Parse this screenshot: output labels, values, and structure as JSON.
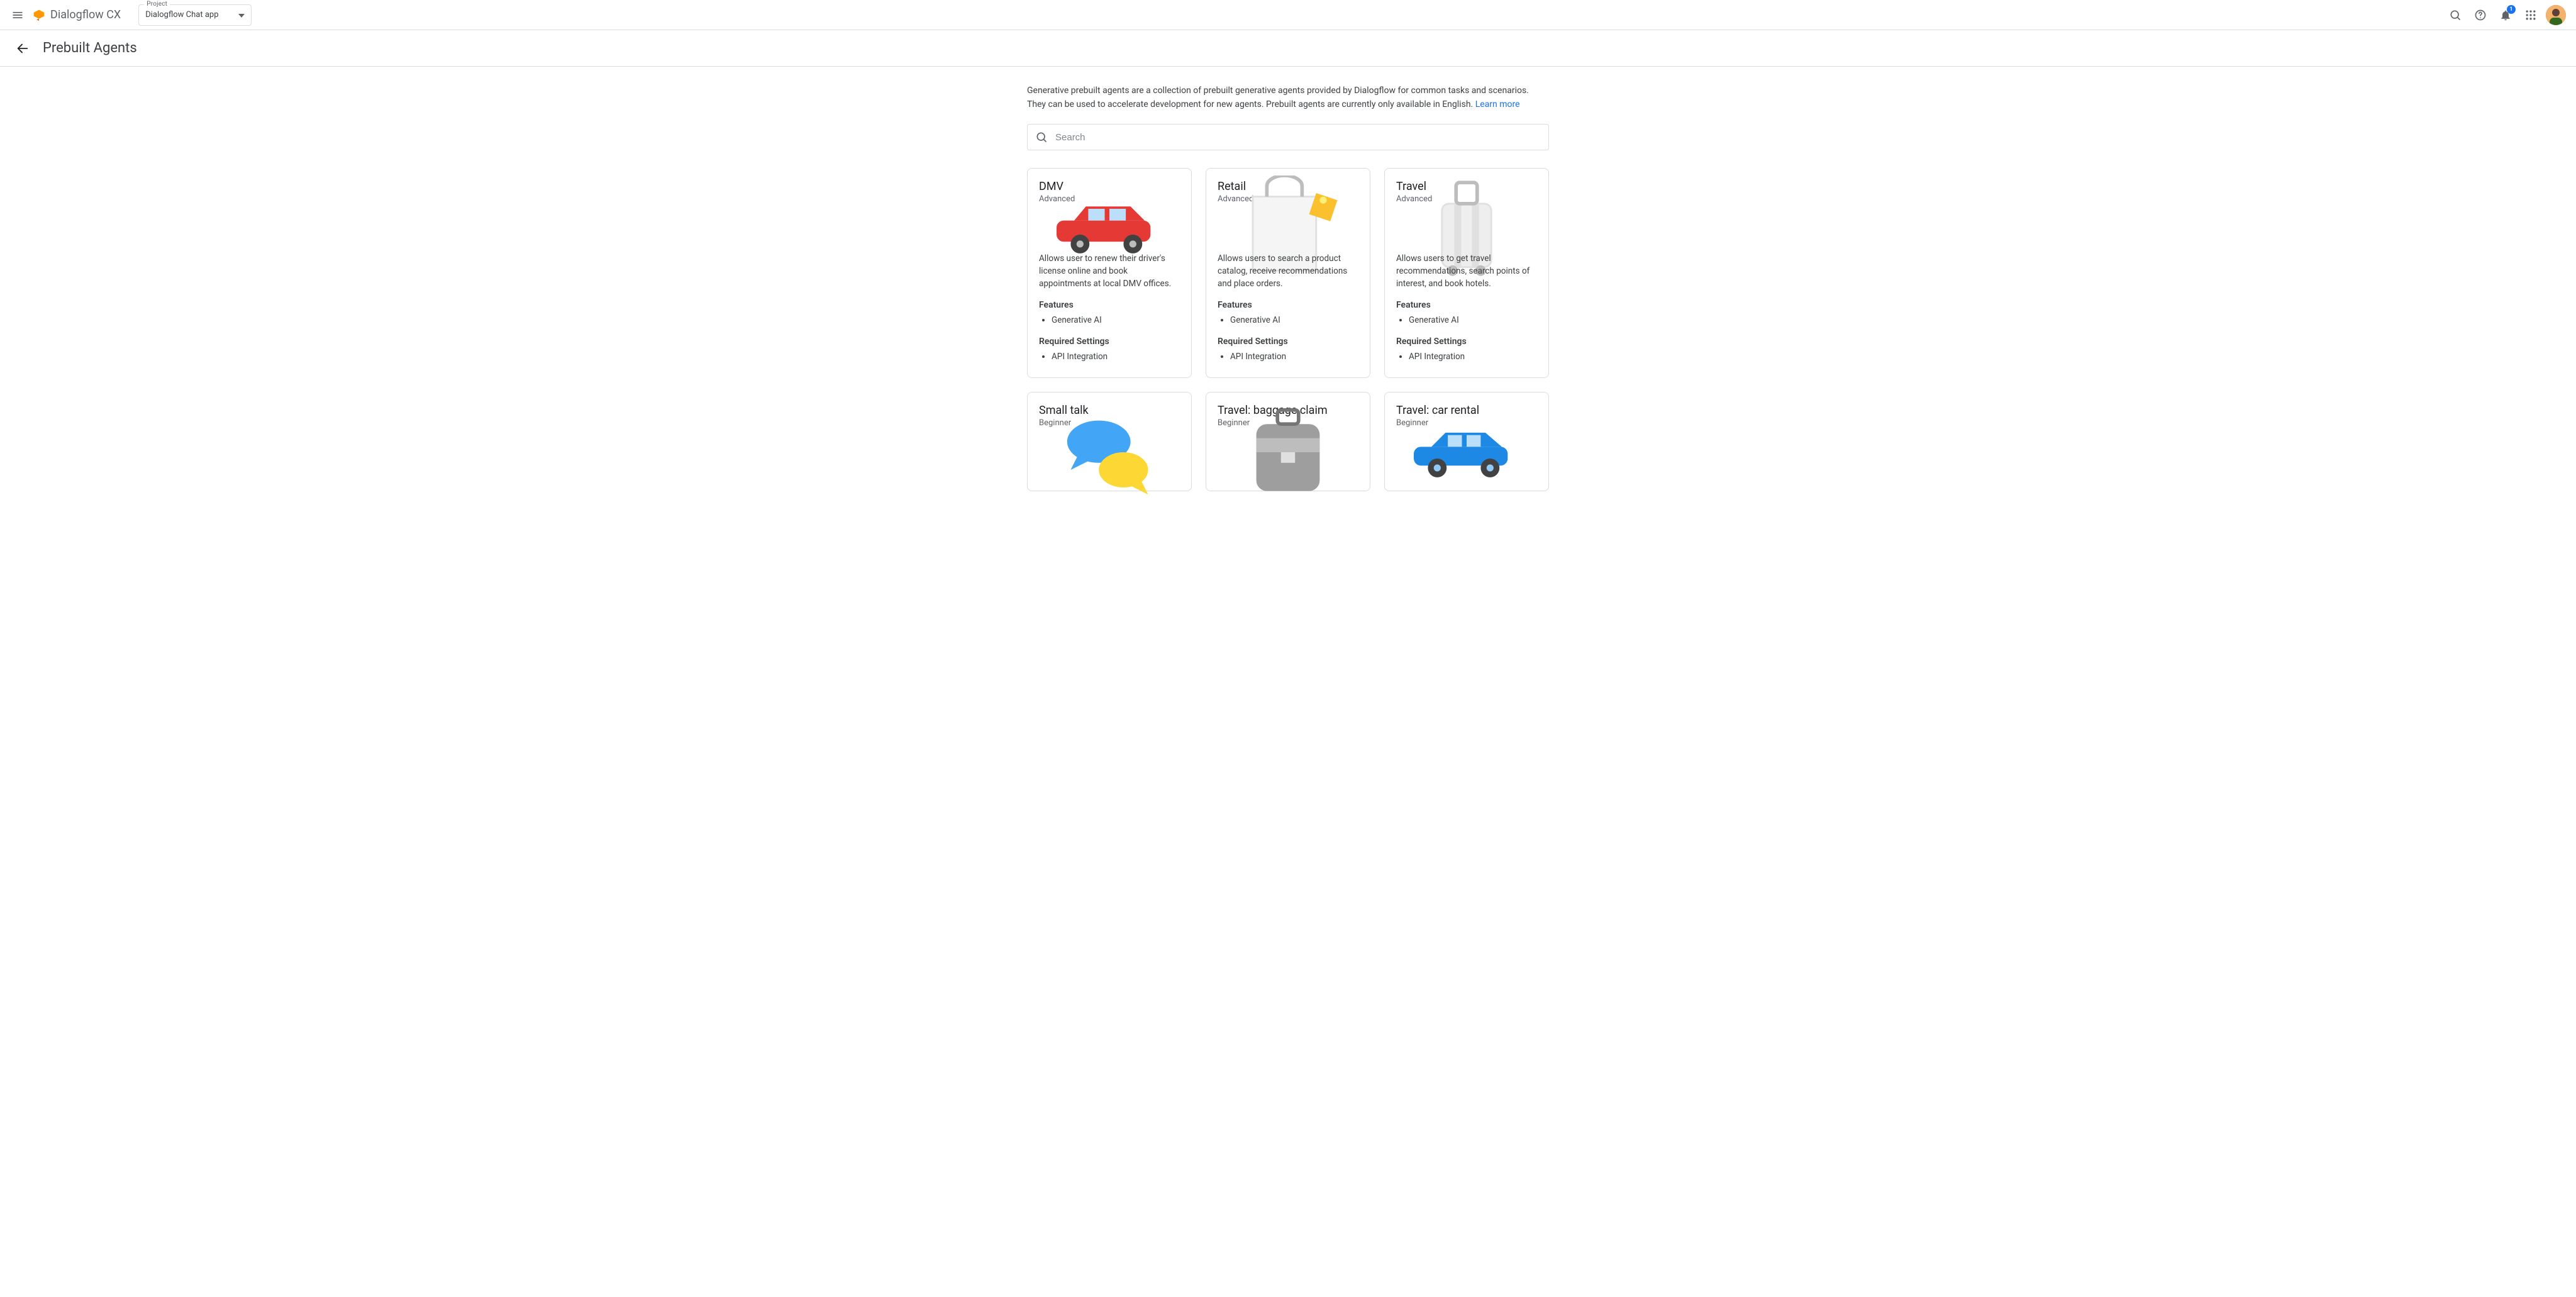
{
  "header": {
    "product_name": "Dialogflow CX",
    "project_label": "Project",
    "project_value": "Dialogflow Chat app",
    "notification_count": "1"
  },
  "subheader": {
    "title": "Prebuilt Agents"
  },
  "intro": {
    "text": "Generative prebuilt agents are a collection of prebuilt generative agents provided by Dialogflow for common tasks and scenarios. They can be used to accelerate development for new agents. Prebuilt agents are currently only available in English. ",
    "link_label": "Learn more"
  },
  "search": {
    "placeholder": "Search"
  },
  "labels": {
    "features": "Features",
    "required_settings": "Required Settings"
  },
  "levels": {
    "advanced": "Advanced",
    "beginner": "Beginner"
  },
  "cards": [
    {
      "id": "dmv",
      "title": "DMV",
      "level": "Advanced",
      "description": "Allows user to renew their driver's license online and book appointments at local DMV offices.",
      "features": [
        "Generative AI"
      ],
      "required_settings": [
        "API Integration"
      ],
      "illustration": "car"
    },
    {
      "id": "retail",
      "title": "Retail",
      "level": "Advanced",
      "description": "Allows users to search a product catalog, receive recommendations and place orders.",
      "features": [
        "Generative AI"
      ],
      "required_settings": [
        "API Integration"
      ],
      "illustration": "bag"
    },
    {
      "id": "travel",
      "title": "Travel",
      "level": "Advanced",
      "description": "Allows users to get travel recommendations, search points of interest, and book hotels.",
      "features": [
        "Generative AI"
      ],
      "required_settings": [
        "API Integration"
      ],
      "illustration": "suitcase"
    },
    {
      "id": "small-talk",
      "title": "Small talk",
      "level": "Beginner",
      "description": "",
      "features": [],
      "required_settings": [],
      "illustration": "chat"
    },
    {
      "id": "travel-baggage-claim",
      "title": "Travel: baggage claim",
      "level": "Beginner",
      "description": "",
      "features": [],
      "required_settings": [],
      "illustration": "luggage"
    },
    {
      "id": "travel-car-rental",
      "title": "Travel: car rental",
      "level": "Beginner",
      "description": "",
      "features": [],
      "required_settings": [],
      "illustration": "bluecar"
    }
  ]
}
